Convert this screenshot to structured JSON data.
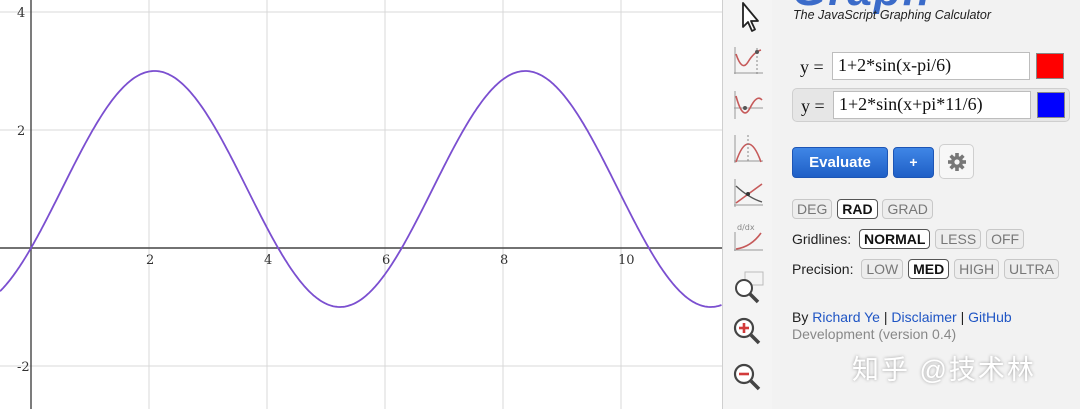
{
  "app": {
    "subtitle": "The JavaScript Graphing Calculator"
  },
  "equations": [
    {
      "label": "y =",
      "value": "1+2*sin(x-pi/6)",
      "color": "#ff0000"
    },
    {
      "label": "y =",
      "value": "1+2*sin(x+pi*11/6)",
      "color": "#0000ff"
    }
  ],
  "buttons": {
    "evaluate": "Evaluate",
    "add": "+"
  },
  "angle_modes": [
    {
      "label": "DEG",
      "active": false
    },
    {
      "label": "RAD",
      "active": true
    },
    {
      "label": "GRAD",
      "active": false
    }
  ],
  "gridlines": {
    "label": "Gridlines:",
    "options": [
      {
        "label": "NORMAL",
        "active": true
      },
      {
        "label": "LESS",
        "active": false
      },
      {
        "label": "OFF",
        "active": false
      }
    ]
  },
  "precision": {
    "label": "Precision:",
    "options": [
      {
        "label": "LOW",
        "active": false
      },
      {
        "label": "MED",
        "active": true
      },
      {
        "label": "HIGH",
        "active": false
      },
      {
        "label": "ULTRA",
        "active": false
      }
    ]
  },
  "credits": {
    "by": "By",
    "author": "Richard Ye",
    "sep": "|",
    "disclaimer": "Disclaimer",
    "github": "GitHub",
    "version": "Development (version 0.4)"
  },
  "watermark": "知乎 @技术林",
  "toolbar_icons": [
    "pointer-icon",
    "trace-icon",
    "root-icon",
    "extremum-icon",
    "intersect-icon",
    "derivative-icon",
    "zoom-box-icon",
    "zoom-in-icon",
    "zoom-out-icon"
  ],
  "graph": {
    "x_ticks": [
      "2",
      "4",
      "6",
      "8",
      "10"
    ],
    "y_ticks": [
      "4",
      "2",
      "-2"
    ],
    "curve_color": "#7b4fd0"
  }
}
